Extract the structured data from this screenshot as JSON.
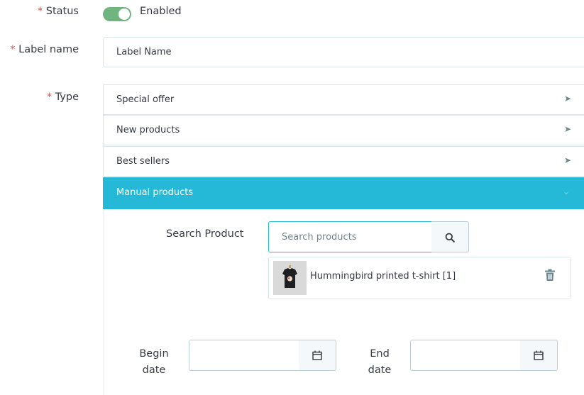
{
  "status": {
    "required_mark": "*",
    "label": "Status",
    "toggle_text": "Enabled",
    "enabled": true
  },
  "label_name": {
    "required_mark": "*",
    "label": "Label name",
    "placeholder": "Label Name"
  },
  "type": {
    "required_mark": "*",
    "label": "Type",
    "options": [
      {
        "label": "Special offer",
        "arrow": "➤"
      },
      {
        "label": "New products",
        "arrow": "➤"
      },
      {
        "label": "Best sellers",
        "arrow": "➤"
      }
    ],
    "active": {
      "label": "Manual products",
      "arrow": "⌄"
    }
  },
  "manual": {
    "search_label": "Search Product",
    "search_placeholder": "Search products",
    "product": {
      "name": "Hummingbird printed t-shirt [1]",
      "thumb_icon": "tshirt-thumbnail"
    },
    "begin_label": "Begin date",
    "end_label": "End date"
  },
  "colors": {
    "accent": "#25b9d7",
    "toggle_on": "#70b580",
    "required": "#e84f4f",
    "text": "#363a41",
    "border": "#dbe6e9"
  }
}
